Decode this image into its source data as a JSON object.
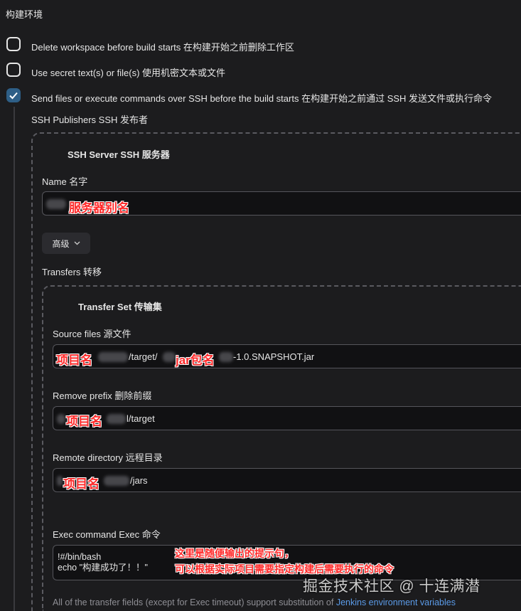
{
  "section_title": "构建环境",
  "options": [
    {
      "label": "Delete workspace before build starts 在构建开始之前删除工作区",
      "checked": false
    },
    {
      "label": "Use secret text(s) or file(s) 使用机密文本或文件",
      "checked": false
    },
    {
      "label": "Send files or execute commands over SSH before the build starts 在构建开始之前通过 SSH 发送文件或执行命令",
      "checked": true
    }
  ],
  "publishers_label": "SSH Publishers SSH 发布者",
  "server": {
    "title": "SSH Server SSH 服务器",
    "name_label": "Name 名字",
    "name_annotation": "服务器别名",
    "advanced_button": "高级"
  },
  "transfers_label": "Transfers 转移",
  "transfer_set": {
    "title": "Transfer Set 传输集",
    "source_label": "Source files 源文件",
    "source_annotation_1": "项目名",
    "source_mid": "/target/",
    "source_annotation_2": "jar包名",
    "source_tail": "-1.0.SNAPSHOT.jar",
    "prefix_label": "Remove prefix 删除前缀",
    "prefix_annotation": "项目名",
    "prefix_tail": "l/target",
    "remote_label": "Remote directory 远程目录",
    "remote_annotation": "项目名",
    "remote_tail": "/jars",
    "exec_label": "Exec command Exec 命令",
    "exec_line1": "!#/bin/bash",
    "exec_line2": "echo \"构建成功了！！\"",
    "exec_annotation_1": "这里是随便输出的提示句，",
    "exec_annotation_2": "可以根据实际项目需要指定构建后需要执行的命令",
    "help_text": "All of the transfer fields (except for Exec timeout) support substitution of ",
    "help_link": "Jenkins environment variables"
  },
  "watermark": "掘金技术社区 @ 十连满潜",
  "colors": {
    "accent": "#2e5f87",
    "annotation": "#ff2a2a",
    "link": "#5b9be8"
  }
}
